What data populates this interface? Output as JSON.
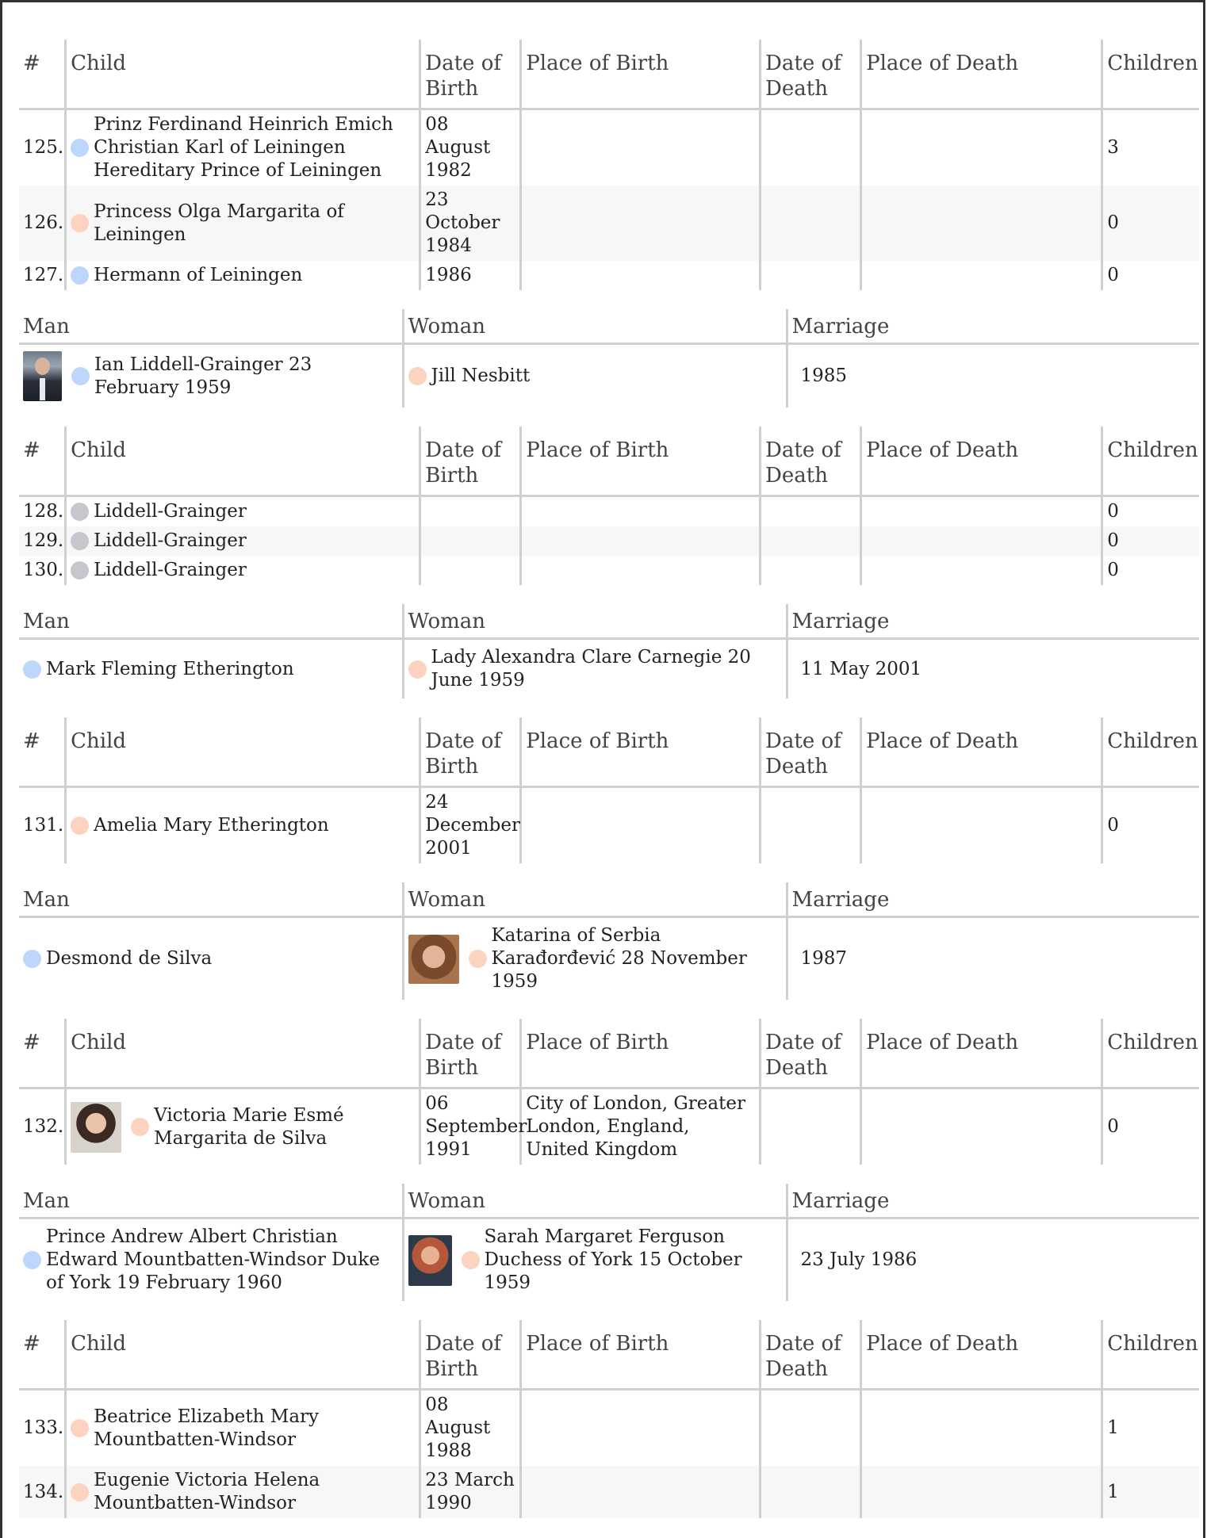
{
  "child_headers": {
    "num": "#",
    "child": "Child",
    "dob": "Date of Birth",
    "pob": "Place of Birth",
    "dod": "Date of Death",
    "pod": "Place of Death",
    "children": "Children"
  },
  "couple_headers": {
    "man": "Man",
    "woman": "Woman",
    "marriage": "Marriage"
  },
  "sections": [
    {
      "children": [
        {
          "num": "125.",
          "gender": "male",
          "name": "Prinz Ferdinand Heinrich Emich Christian Karl of Leiningen Hereditary Prince of Leiningen",
          "dob": "08 August 1982",
          "pob": "",
          "dod": "",
          "pod": "",
          "children": "3"
        },
        {
          "num": "126.",
          "gender": "female",
          "name": "Princess Olga Margarita of Leiningen",
          "dob": "23 October 1984",
          "pob": "",
          "dod": "",
          "pod": "",
          "children": "0"
        },
        {
          "num": "127.",
          "gender": "male",
          "name": "Hermann of Leiningen",
          "dob": "1986",
          "pob": "",
          "dod": "",
          "pod": "",
          "children": "0"
        }
      ]
    },
    {
      "couple": {
        "man": "Ian Liddell-Grainger 23 February 1959",
        "man_photo": "p-man",
        "woman": "Jill Nesbitt",
        "woman_photo": "",
        "marriage": "1985"
      },
      "children": [
        {
          "num": "128.",
          "gender": "unknown",
          "name": "Liddell-Grainger",
          "dob": "",
          "pob": "",
          "dod": "",
          "pod": "",
          "children": "0"
        },
        {
          "num": "129.",
          "gender": "unknown",
          "name": "Liddell-Grainger",
          "dob": "",
          "pob": "",
          "dod": "",
          "pod": "",
          "children": "0"
        },
        {
          "num": "130.",
          "gender": "unknown",
          "name": "Liddell-Grainger",
          "dob": "",
          "pob": "",
          "dod": "",
          "pod": "",
          "children": "0"
        }
      ]
    },
    {
      "couple": {
        "man": "Mark Fleming Etherington",
        "man_photo": "",
        "woman": "Lady Alexandra Clare Carnegie 20 June 1959",
        "woman_photo": "",
        "marriage": "11 May 2001"
      },
      "children": [
        {
          "num": "131.",
          "gender": "female",
          "name": "Amelia Mary Etherington",
          "dob": "24 December 2001",
          "pob": "",
          "dod": "",
          "pod": "",
          "children": "0"
        }
      ]
    },
    {
      "couple": {
        "man": "Desmond de Silva",
        "man_photo": "",
        "woman": "Katarina of Serbia Karađorđević 28 November 1959",
        "woman_photo": "p-woman1",
        "marriage": "1987"
      },
      "children": [
        {
          "num": "132.",
          "gender": "female",
          "photo": "p-girl",
          "name": "Victoria Marie Esmé Margarita de Silva",
          "dob": "06 September 1991",
          "pob": "City of London, Greater London, England, United Kingdom",
          "dod": "",
          "pod": "",
          "children": "0"
        }
      ]
    },
    {
      "couple": {
        "man": "Prince Andrew Albert Christian Edward Mountbatten-Windsor Duke of York 19 February 1960",
        "man_photo": "",
        "woman": "Sarah Margaret Ferguson Duchess of York 15 October 1959",
        "woman_photo": "p-sarah",
        "marriage": "23 July 1986"
      },
      "children": [
        {
          "num": "133.",
          "gender": "female",
          "name": "Beatrice Elizabeth Mary Mountbatten-Windsor",
          "dob": "08 August 1988",
          "pob": "",
          "dod": "",
          "pod": "",
          "children": "1"
        },
        {
          "num": "134.",
          "gender": "female",
          "name": "Eugenie Victoria Helena Mountbatten-Windsor",
          "dob": "23 March 1990",
          "pob": "",
          "dod": "",
          "pod": "",
          "children": "1"
        }
      ]
    }
  ]
}
